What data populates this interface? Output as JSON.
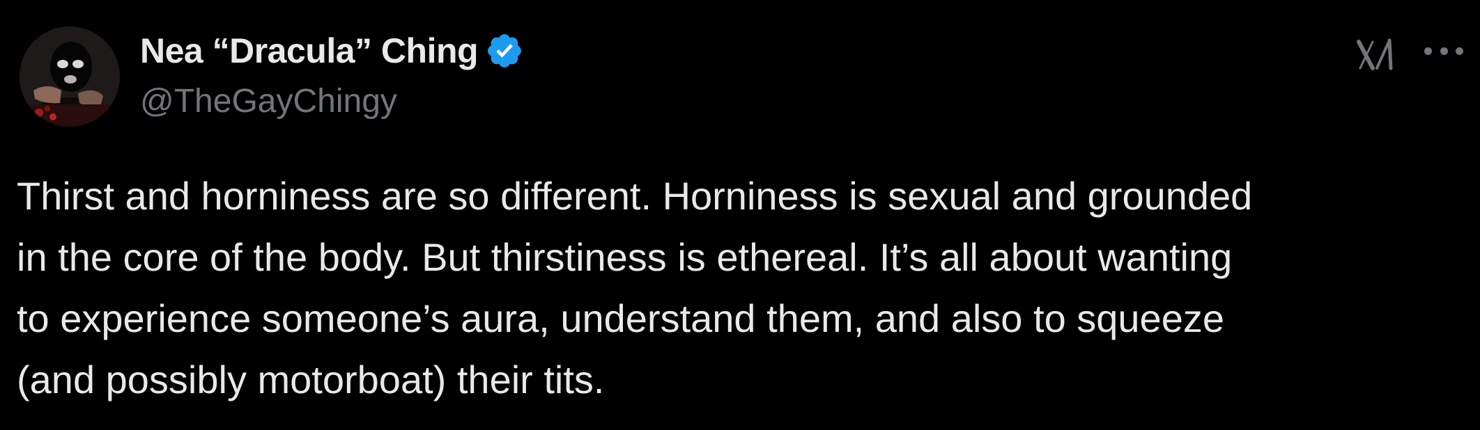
{
  "author": {
    "display_name": "Nea “Dracula” Ching",
    "handle": "@TheGayChingy",
    "verified": true,
    "avatar_icon": "profile-photo"
  },
  "header_icons": {
    "brand_icon": "x-logo-icon",
    "more_icon": "ellipsis-icon"
  },
  "tweet": {
    "lines": [
      "Thirst and horniness are so different. Horniness is sexual and grounded",
      "in the core of the body. But thirstiness is ethereal. It’s all about wanting",
      "to experience someone’s aura, understand them, and also to squeeze",
      "(and possibly motorboat) their tits."
    ]
  },
  "colors": {
    "background": "#000000",
    "text_primary": "#e7e9ea",
    "text_secondary": "#71767b",
    "verified_badge": "#1d9bf0"
  }
}
